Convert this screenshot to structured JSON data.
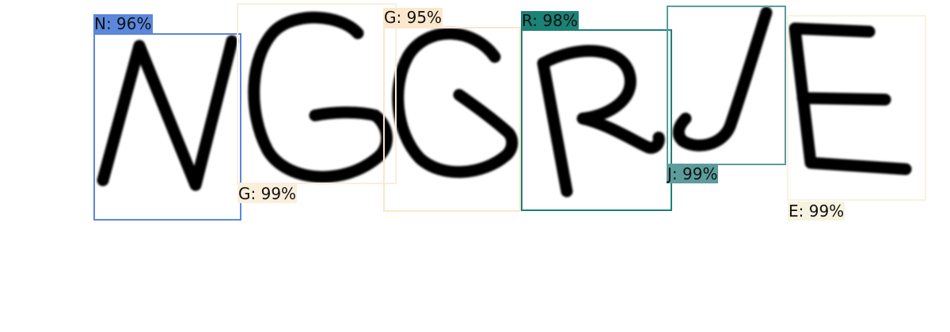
{
  "detections": [
    {
      "label": "N: 96%",
      "color": "#5b87dd"
    },
    {
      "label": "G: 99%",
      "color": "#fbeedb"
    },
    {
      "label": "G: 95%",
      "color": "#fbe7cc"
    },
    {
      "label": "R: 98%",
      "color": "#1b8276"
    },
    {
      "label": "J: 99%",
      "color": "#5c9c9c"
    },
    {
      "label": "E: 99%",
      "color": "#f7f3e0"
    }
  ]
}
